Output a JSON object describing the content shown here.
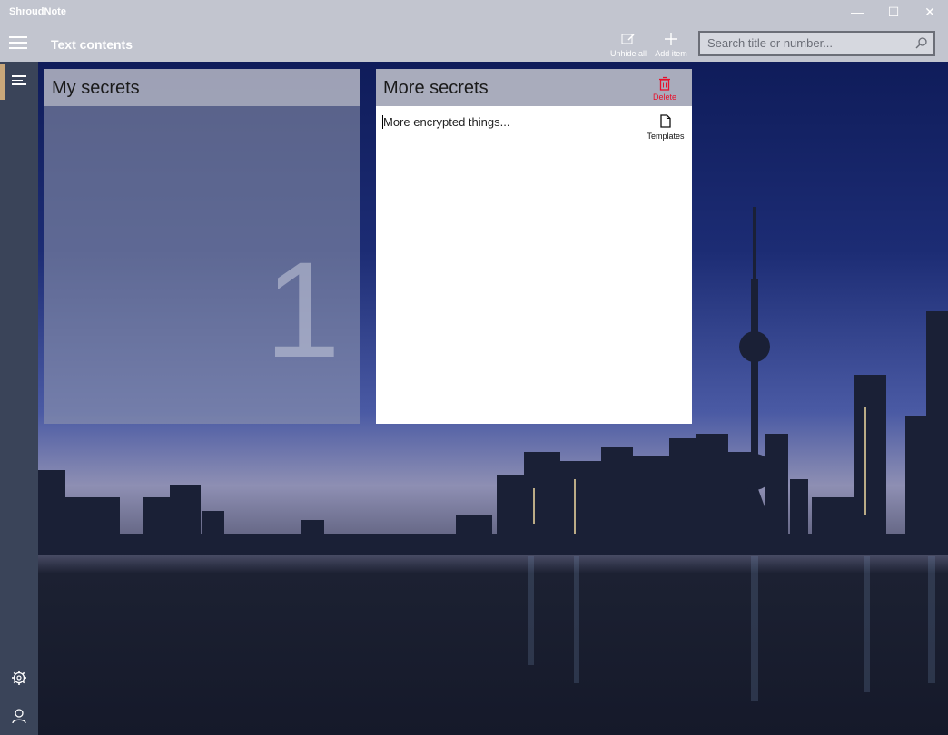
{
  "window": {
    "app_name": "ShroudNote",
    "controls": {
      "minimize": "—",
      "maximize": "☐",
      "close": "✕"
    }
  },
  "header": {
    "title": "Text contents",
    "toolbar": {
      "unhide_all_label": "Unhide all",
      "add_item_label": "Add item"
    },
    "search": {
      "placeholder": "Search title or number..."
    }
  },
  "cards": [
    {
      "title": "My secrets",
      "number": "1"
    },
    {
      "title": "More secrets",
      "content": "More encrypted things...",
      "delete_label": "Delete",
      "templates_label": "Templates"
    }
  ],
  "colors": {
    "delete": "#e8102a",
    "header_bg": "#c2c5cf",
    "rail_bg": "#3a4459",
    "rail_accent": "#c9a77a"
  },
  "icons": [
    "hamburger-icon",
    "unhide-icon",
    "add-icon",
    "search-icon",
    "nav-menu-icon",
    "settings-icon",
    "user-icon",
    "delete-icon",
    "template-icon"
  ]
}
